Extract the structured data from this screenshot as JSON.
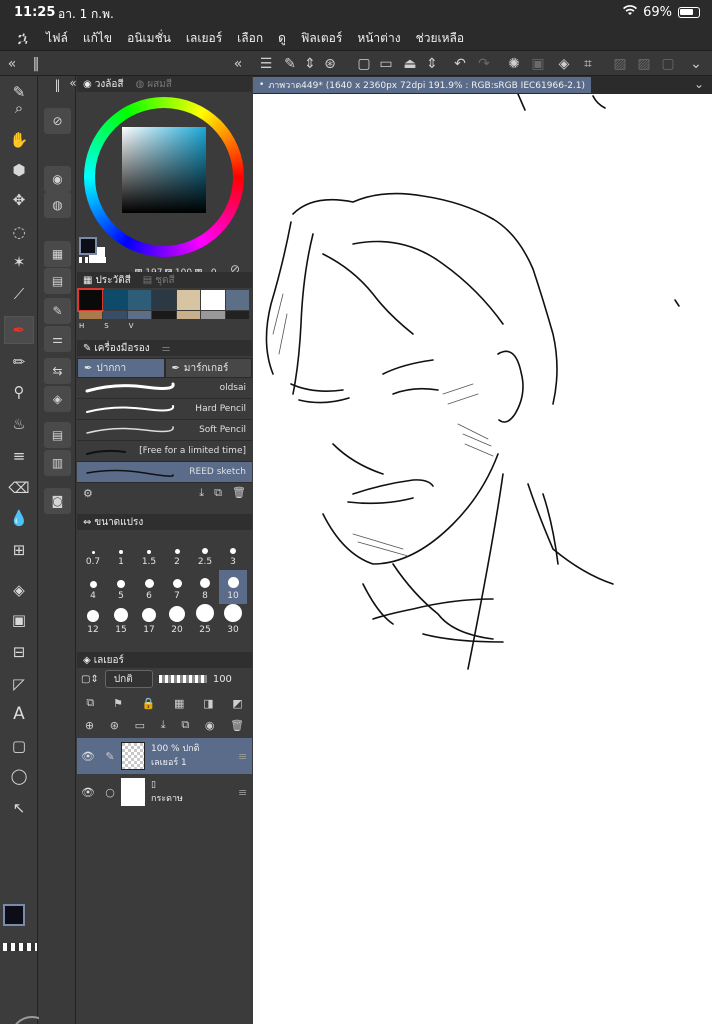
{
  "status_bar": {
    "time": "11:25",
    "date": "อา. 1 ก.พ.",
    "battery": "69%"
  },
  "menu": [
    "ไฟล์",
    "แก้ไข",
    "อนิเมชั่น",
    "เลเยอร์",
    "เลือก",
    "ดู",
    "ฟิลเตอร์",
    "หน้าต่าง",
    "ช่วยเหลือ"
  ],
  "document": {
    "tab_title": "ภาพวาด449* (1640 x 2360px 72dpi 191.9% : RGB:sRGB IEC61966-2.1)"
  },
  "color_panel": {
    "tab_wheel": "วงล้อสี",
    "tab_mix": "ผสมสี",
    "h_label": "H",
    "h_value": "197",
    "s_label": "S",
    "s_value": "100",
    "v_label": "V",
    "v_value": "0"
  },
  "history_panel": {
    "tab_history": "ประวัติสี",
    "tab_set": "ชุดสี",
    "swatches": [
      "#0a0a0a",
      "#0e4a6a",
      "#2e5d78",
      "#2a3944",
      "#d6c5a0",
      "#ffffff",
      "#5c6f86"
    ],
    "swatches_row2": [
      "#a87b4a",
      "#3a4d66",
      "#5c6f86",
      "#1a1a1a",
      "#c7b08a",
      "#999999",
      "#222222"
    ],
    "labels": [
      "H",
      "S",
      "V"
    ]
  },
  "subtool_panel": {
    "title": "เครื่องมือรอง",
    "tab_pen": "ปากกา",
    "tab_marker": "มาร์กเกอร์",
    "brushes": [
      {
        "name": "oldsai"
      },
      {
        "name": "Hard Pencil"
      },
      {
        "name": "Soft Pencil"
      },
      {
        "name": "[Free for a limited time]"
      },
      {
        "name": "REED sketch"
      }
    ]
  },
  "brush_size_panel": {
    "title": "ขนาดแปรง",
    "sizes": [
      "0.7",
      "1",
      "1.5",
      "2",
      "2.5",
      "3",
      "4",
      "5",
      "6",
      "7",
      "8",
      "10",
      "12",
      "15",
      "17",
      "20",
      "25",
      "30"
    ],
    "selected": "10"
  },
  "layer_panel": {
    "title": "เลเยอร์",
    "blend_mode": "ปกติ",
    "opacity": "100",
    "layers": [
      {
        "line1": "100 %  ปกติ",
        "line2": "เลเยอร์ 1"
      },
      {
        "line1": "",
        "line2": "กระดาษ"
      }
    ]
  }
}
